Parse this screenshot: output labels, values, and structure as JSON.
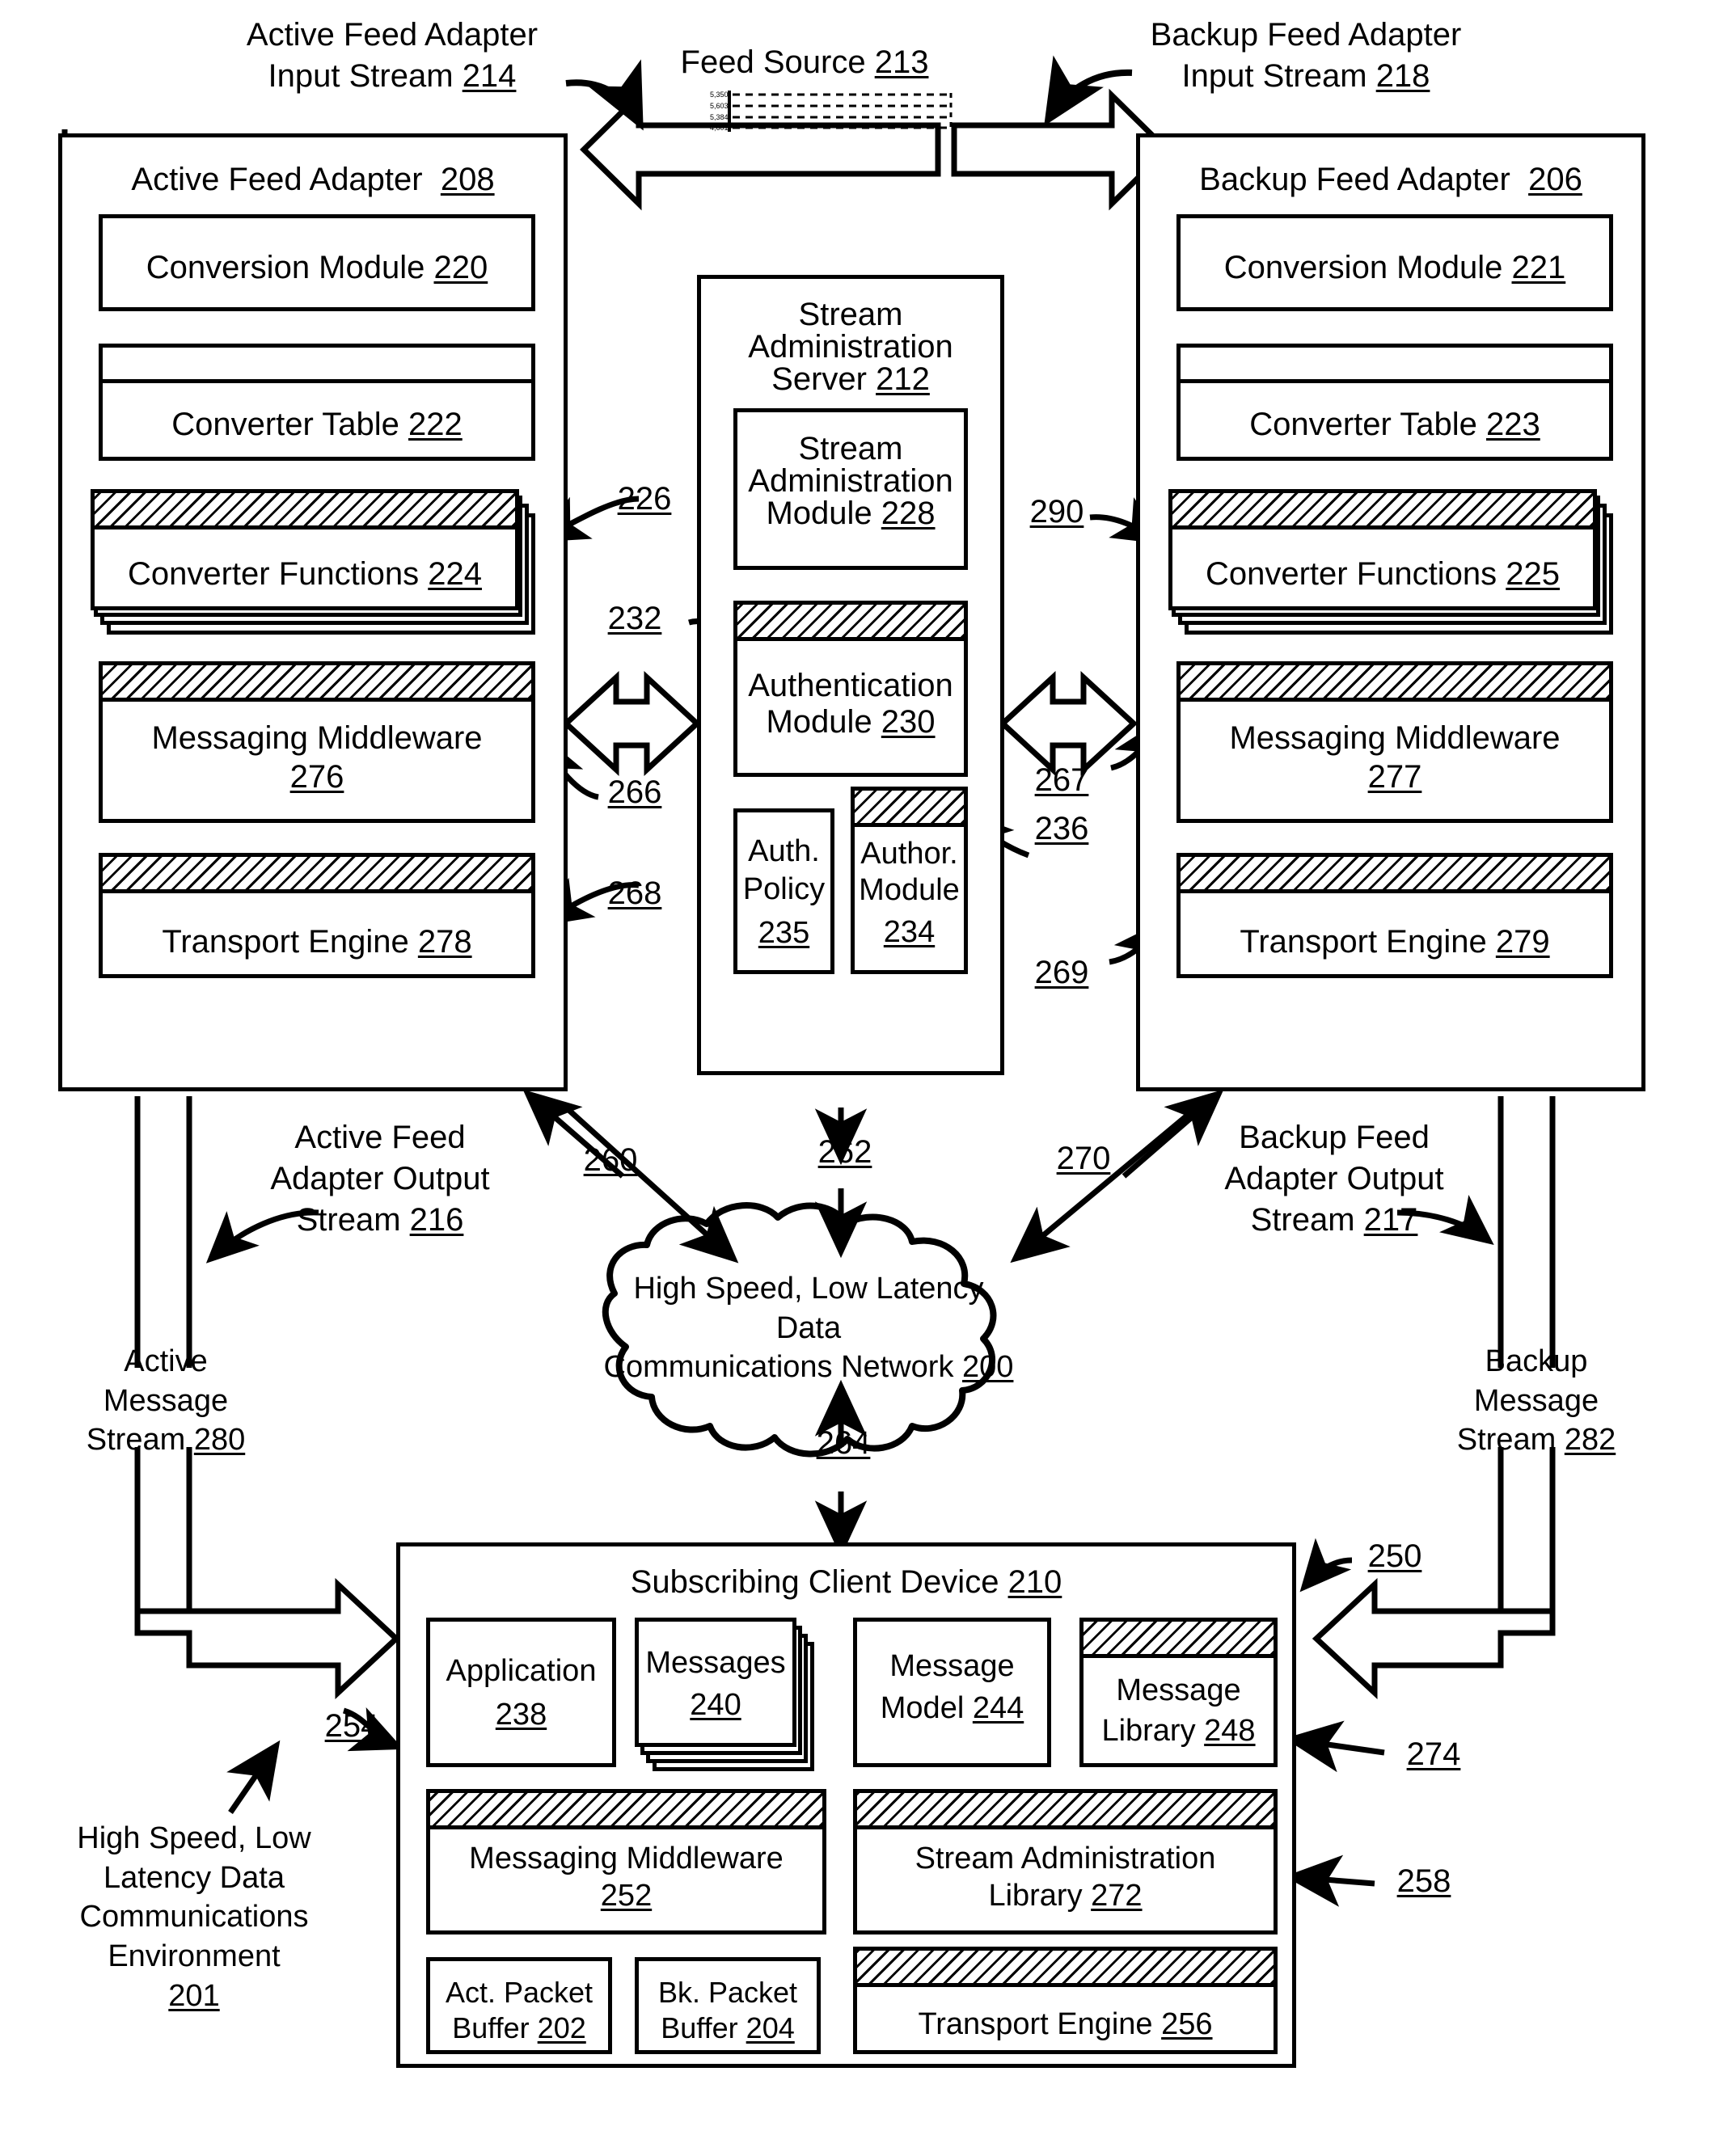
{
  "figure": {
    "type": "patent-block-diagram",
    "environment_label": "High Speed, Low Latency Data Communications Environment",
    "environment_ref": "201"
  },
  "top_labels": {
    "active_input_stream": "Active Feed Adapter\nInput Stream",
    "active_input_stream_ref": "214",
    "feed_source": "Feed Source",
    "feed_source_ref": "213",
    "backup_input_stream": "Backup Feed Adapter\nInput Stream",
    "backup_input_stream_ref": "218"
  },
  "active_adapter": {
    "title": "Active Feed Adapter",
    "title_ref": "208",
    "conversion_module": "Conversion Module",
    "conversion_module_ref": "220",
    "converter_table": "Converter Table",
    "converter_table_ref": "222",
    "converter_functions": "Converter Functions",
    "converter_functions_ref": "224",
    "messaging_middleware": "Messaging Middleware",
    "messaging_middleware_ref": "276",
    "transport_engine": "Transport Engine",
    "transport_engine_ref": "278"
  },
  "backup_adapter": {
    "title": "Backup Feed Adapter",
    "title_ref": "206",
    "conversion_module": "Conversion Module",
    "conversion_module_ref": "221",
    "converter_table": "Converter Table",
    "converter_table_ref": "223",
    "converter_functions": "Converter Functions",
    "converter_functions_ref": "225",
    "messaging_middleware": "Messaging Middleware",
    "messaging_middleware_ref": "277",
    "transport_engine": "Transport Engine",
    "transport_engine_ref": "279"
  },
  "admin_server": {
    "title": "Stream\nAdministration\nServer",
    "title_ref": "212",
    "stream_admin_module": "Stream\nAdministration\nModule",
    "stream_admin_module_ref": "228",
    "authentication_module": "Authentication\nModule",
    "authentication_module_ref": "230",
    "auth_policy": "Auth.\nPolicy",
    "auth_policy_ref": "235",
    "author_module": "Author.\nModule",
    "author_module_ref": "234"
  },
  "network_cloud": {
    "label_line1": "High Speed, Low Latency Data",
    "label_line2": "Communications Network",
    "ref": "200"
  },
  "client_device": {
    "title": "Subscribing Client Device",
    "title_ref": "210",
    "application": "Application",
    "application_ref": "238",
    "messages": "Messages",
    "messages_ref": "240",
    "message_model": "Message\nModel",
    "message_model_ref": "244",
    "message_library": "Message\nLibrary",
    "message_library_ref": "248",
    "messaging_middleware": "Messaging Middleware",
    "messaging_middleware_ref": "252",
    "stream_admin_library": "Stream Administration\nLibrary",
    "stream_admin_library_ref": "272",
    "act_packet_buffer": "Act. Packet\nBuffer",
    "act_packet_buffer_ref": "202",
    "bk_packet_buffer": "Bk. Packet\nBuffer",
    "bk_packet_buffer_ref": "204",
    "transport_engine": "Transport Engine",
    "transport_engine_ref": "256"
  },
  "stream_labels": {
    "active_output": "Active Feed\nAdapter Output\nStream",
    "active_output_ref": "216",
    "backup_output": "Backup Feed\nAdapter Output\nStream",
    "backup_output_ref": "217",
    "active_message_stream": "Active\nMessage\nStream",
    "active_message_stream_ref": "280",
    "backup_message_stream": "Backup\nMessage\nStream",
    "backup_message_stream_ref": "282",
    "environment": "High Speed, Low\nLatency Data\nCommunications\nEnvironment",
    "environment_ref": "201"
  },
  "ref_numbers": {
    "r226": "226",
    "r232": "232",
    "r266": "266",
    "r268": "268",
    "r290": "290",
    "r267": "267",
    "r236": "236",
    "r269": "269",
    "r260": "260",
    "r262": "262",
    "r270": "270",
    "r264": "264",
    "r250": "250",
    "r254": "254",
    "r274": "274",
    "r258": "258"
  },
  "colors": {
    "ink": "#000000",
    "paper": "#ffffff"
  }
}
